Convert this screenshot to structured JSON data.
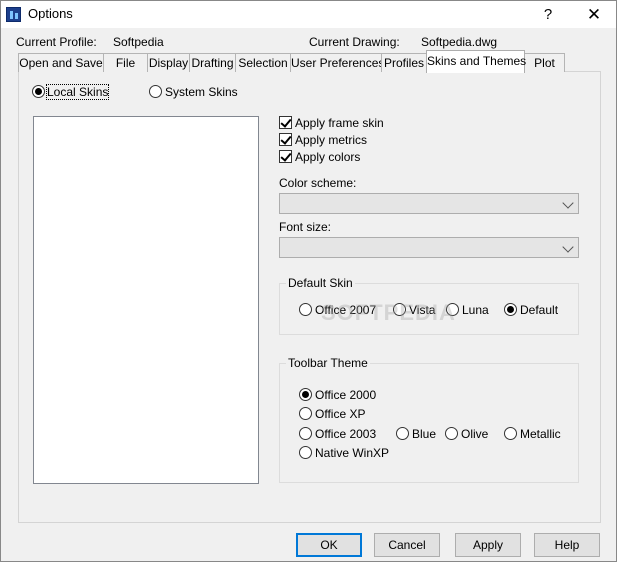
{
  "window": {
    "title": "Options",
    "help_glyph": "?",
    "close_glyph": "✕"
  },
  "info": {
    "profile_label": "Current Profile:",
    "profile_value": "Softpedia",
    "drawing_label": "Current Drawing:",
    "drawing_value": "Softpedia.dwg"
  },
  "tabs": [
    {
      "label": "Open and Save"
    },
    {
      "label": "File"
    },
    {
      "label": "Display"
    },
    {
      "label": "Drafting"
    },
    {
      "label": "Selection"
    },
    {
      "label": "User Preferences"
    },
    {
      "label": "Profiles"
    },
    {
      "label": "Skins and Themes",
      "active": true
    },
    {
      "label": "Plot"
    }
  ],
  "skins_source": {
    "local_label": "Local Skins",
    "system_label": "System Skins",
    "selected": "local"
  },
  "options": {
    "apply_frame_skin": {
      "label": "Apply frame skin",
      "checked": true
    },
    "apply_metrics": {
      "label": "Apply metrics",
      "checked": true
    },
    "apply_colors": {
      "label": "Apply colors",
      "checked": true
    }
  },
  "color_scheme": {
    "label": "Color scheme:",
    "value": ""
  },
  "font_size": {
    "label": "Font size:",
    "value": ""
  },
  "default_skin": {
    "title": "Default Skin",
    "options": [
      "Office 2007",
      "Vista",
      "Luna",
      "Default"
    ],
    "selected": "Default"
  },
  "toolbar_theme": {
    "title": "Toolbar Theme",
    "options": [
      "Office 2000",
      "Office XP",
      "Office 2003",
      "Blue",
      "Olive",
      "Metallic",
      "Native WinXP"
    ],
    "selected": "Office 2000"
  },
  "watermark": "SOFTPEDIA",
  "buttons": {
    "ok": "OK",
    "cancel": "Cancel",
    "apply": "Apply",
    "help": "Help"
  },
  "colors": {
    "accent": "#0078d7",
    "panel": "#f0f0f0"
  }
}
